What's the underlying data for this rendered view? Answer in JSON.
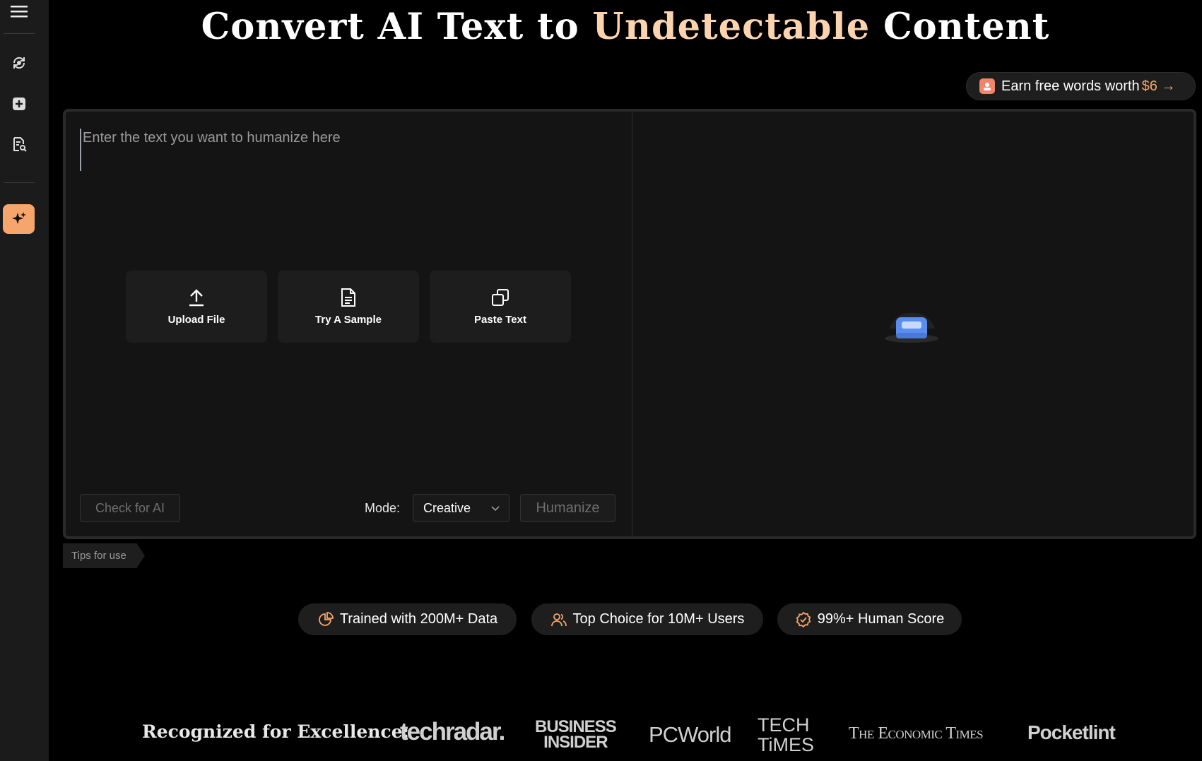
{
  "sidebar": {
    "items": [
      {
        "name": "menu-icon"
      },
      {
        "name": "refresh-icon"
      },
      {
        "name": "add-icon"
      },
      {
        "name": "doc-search-icon"
      },
      {
        "name": "sparkle-icon",
        "active": true
      }
    ]
  },
  "headline": {
    "part1": "Convert AI Text to ",
    "accent": "Undetectable",
    "part2": " Content",
    "accent_color": "#fbd3ae"
  },
  "earn": {
    "text": "Earn free words worth",
    "amount": "$6 →"
  },
  "editor": {
    "placeholder": "Enter the text you want to humanize here",
    "value": ""
  },
  "actions": [
    {
      "label": "Upload File",
      "icon": "upload-icon"
    },
    {
      "label": "Try A Sample",
      "icon": "document-icon"
    },
    {
      "label": "Paste Text",
      "icon": "paste-icon"
    }
  ],
  "controls": {
    "check_label": "Check for AI",
    "mode_label": "Mode:",
    "mode_value": "Creative",
    "humanize_label": "Humanize"
  },
  "tips": "Tips for use",
  "stats": [
    {
      "label": "Trained with 200M+ Data",
      "icon": "pie-chart-icon"
    },
    {
      "label": "Top Choice for 10M+ Users",
      "icon": "users-icon"
    },
    {
      "label": "99%+ Human Score",
      "icon": "verified-icon"
    }
  ],
  "recognition": {
    "label": "Recognized for Excellence:",
    "logos": [
      "techradar.",
      "BUSINESS",
      "INSIDER",
      "PCWorld",
      "TECH",
      "TiMES",
      "The Economic Times",
      "Pocketlint"
    ]
  },
  "colors": {
    "accent": "#f6a66c",
    "panel_bg": "#141414",
    "sidebar_bg": "#1b1b1b"
  }
}
